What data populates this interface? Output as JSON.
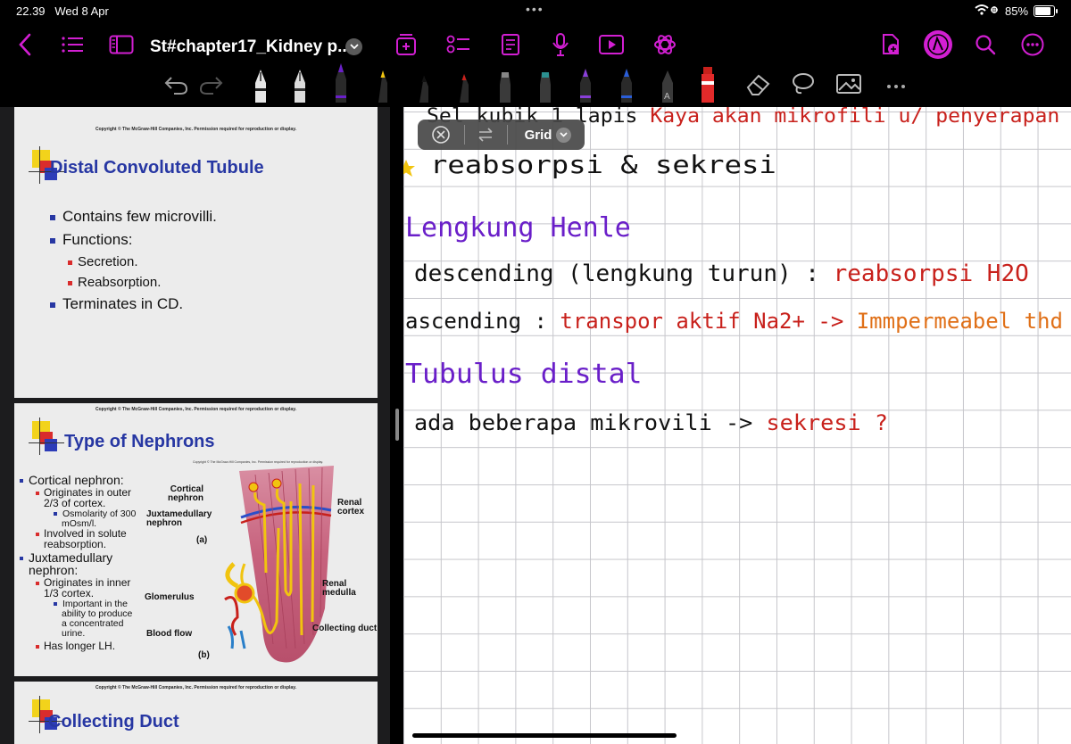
{
  "status_bar": {
    "time": "22.39",
    "date": "Wed 8 Apr",
    "battery": "85%",
    "battery_level": 0.85
  },
  "document": {
    "title": "St#chapter17_Kidney p..."
  },
  "colors": {
    "accent": "#d21fd2",
    "canvas": "#ffffff",
    "grid": "#c6c6cb"
  },
  "grid_popup": {
    "label": "Grid"
  },
  "slides": [
    {
      "copyright_top": "Copyright © The McGraw-Hill Companies, Inc. Permission required for reproduction or display.",
      "title": "Distal Convoluted Tubule",
      "bullets": [
        "Contains few microvilli.",
        "Functions:",
        "Terminates in CD."
      ],
      "sub_bullets": [
        "Secretion.",
        "Reabsorption."
      ]
    },
    {
      "copyright_top": "Copyright © The McGraw-Hill Companies, Inc. Permission required for reproduction or display.",
      "title": "Type of Nephrons",
      "figure_copyright": "Copyright © The McGraw-Hill Companies, Inc. Permission required for reproduction or display.",
      "items": [
        {
          "level": 1,
          "text": "Cortical nephron:"
        },
        {
          "level": 2,
          "text": "Originates in outer"
        },
        {
          "level": 2,
          "text": "2/3 of cortex."
        },
        {
          "level": 3,
          "text": "Osmolarity of 300"
        },
        {
          "level": 3,
          "text": "mOsm/l."
        },
        {
          "level": 2,
          "text": "Involved in solute"
        },
        {
          "level": 2,
          "text": "reabsorption."
        },
        {
          "level": 1,
          "text": "Juxtamedullary"
        },
        {
          "level": 1,
          "text": "nephron:"
        },
        {
          "level": 2,
          "text": "Originates in inner"
        },
        {
          "level": 2,
          "text": "1/3 cortex."
        },
        {
          "level": 3,
          "text": "Important in the"
        },
        {
          "level": 3,
          "text": "ability to produce"
        },
        {
          "level": 3,
          "text": "a concentrated"
        },
        {
          "level": 3,
          "text": "urine."
        },
        {
          "level": 2,
          "text": "Has longer LH."
        }
      ],
      "diagram_labels": {
        "cortical_nephron": [
          "Cortical",
          "nephron"
        ],
        "juxtamedullary_nephron": [
          "Juxtamedullary",
          "nephron"
        ],
        "a": "(a)",
        "glomerulus": "Glomerulus",
        "blood_flow": "Blood flow",
        "b": "(b)",
        "renal_cortex": [
          "Renal",
          "cortex"
        ],
        "renal_medulla": [
          "Renal",
          "medulla"
        ],
        "collecting_duct": "Collecting duct"
      }
    },
    {
      "copyright_top": "Copyright © The McGraw-Hill Companies, Inc. Permission required for reproduction or display.",
      "title": "Collecting Duct"
    }
  ],
  "handwriting": [
    {
      "parts": [
        {
          "text": "Sel  kubik  1 lapis ",
          "color": "#111111"
        },
        {
          "text": "Kaya akan mikrofili u/ penyerapan",
          "color": "#c8211c"
        }
      ]
    },
    {
      "parts": [
        {
          "text": "reabsorpsi & sekresi",
          "color": "#111111"
        }
      ]
    },
    {
      "parts": [
        {
          "text": "Lengkung Henle",
          "color": "#6a1fc9"
        }
      ]
    },
    {
      "parts": [
        {
          "text": "descending (lengkung turun) : ",
          "color": "#111111"
        },
        {
          "text": "reabsorpsi H2O",
          "color": "#c8211c"
        }
      ]
    },
    {
      "parts": [
        {
          "text": "ascending : ",
          "color": "#111111"
        },
        {
          "text": "transpor aktif Na2+ -> ",
          "color": "#c8211c"
        },
        {
          "text": "Immpermeabel thd",
          "color": "#e07018"
        }
      ]
    },
    {
      "parts": [
        {
          "text": "Tubulus distal",
          "color": "#6a1fc9"
        }
      ]
    },
    {
      "parts": [
        {
          "text": "ada beberapa mikrovili -> ",
          "color": "#111111"
        },
        {
          "text": "sekresi ?",
          "color": "#c8211c"
        }
      ]
    }
  ]
}
